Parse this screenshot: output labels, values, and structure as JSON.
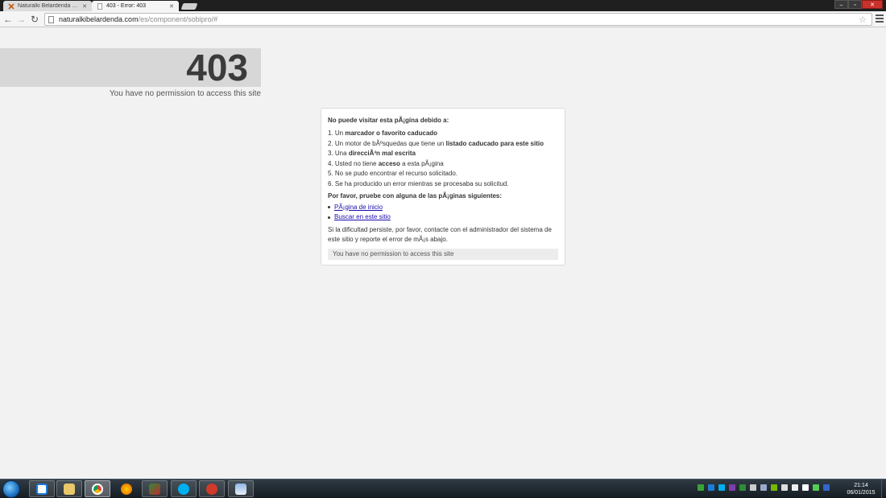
{
  "browser": {
    "tabs": [
      {
        "title": "Naturalki Belardenda - Ac",
        "active": false
      },
      {
        "title": "403 - Error: 403",
        "active": true
      }
    ],
    "window_controls": {
      "minimize": "–",
      "maximize": "▫",
      "close": "✕"
    },
    "url": {
      "host": "naturalkibelardenda.com",
      "path": "/es/component/sobipro/#"
    }
  },
  "page": {
    "error_code": "403",
    "tagline": "You have no permission to access this site",
    "panel": {
      "heading": "No puede visitar esta pÃ¡gina debido a:",
      "reasons": [
        {
          "num": "1.",
          "pre": "Un ",
          "bold": "marcador o favorito caducado",
          "post": ""
        },
        {
          "num": "2.",
          "pre": "Un motor de bÃºsquedas que tiene un ",
          "bold": "listado caducado para este sitio",
          "post": ""
        },
        {
          "num": "3.",
          "pre": "Una ",
          "bold": "direcciÃ³n mal escrita",
          "post": ""
        },
        {
          "num": "4.",
          "pre": "Usted no tiene ",
          "bold": "acceso",
          "post": " a esta pÃ¡gina"
        },
        {
          "num": "5.",
          "pre": "No se pudo encontrar el recurso solicitado.",
          "bold": "",
          "post": ""
        },
        {
          "num": "6.",
          "pre": "Se ha producido un error mientras se procesaba su solicitud.",
          "bold": "",
          "post": ""
        }
      ],
      "try_heading": "Por favor, pruebe con alguna de las pÃ¡ginas siguientes:",
      "links": [
        "PÃ¡gina de inicio",
        "Buscar en este sitio"
      ],
      "note": "Si la dificultad persiste, por favor, contacte con el administrador del sistema de este sitio y reporte el error de mÃ¡s abajo.",
      "message": "You have no permission to access this site"
    }
  },
  "taskbar": {
    "apps": [
      "dropbox-icon",
      "file-explorer-icon",
      "chrome-icon",
      "firefox-icon",
      "filezilla-icon",
      "skype-icon",
      "ccleaner-icon",
      "paint-icon"
    ],
    "clock": {
      "time": "21:14",
      "date": "06/01/2015"
    }
  },
  "colors": {
    "link": "#1a0dab",
    "error_band": "#d7d7d7",
    "close_button": "#c8322b"
  }
}
